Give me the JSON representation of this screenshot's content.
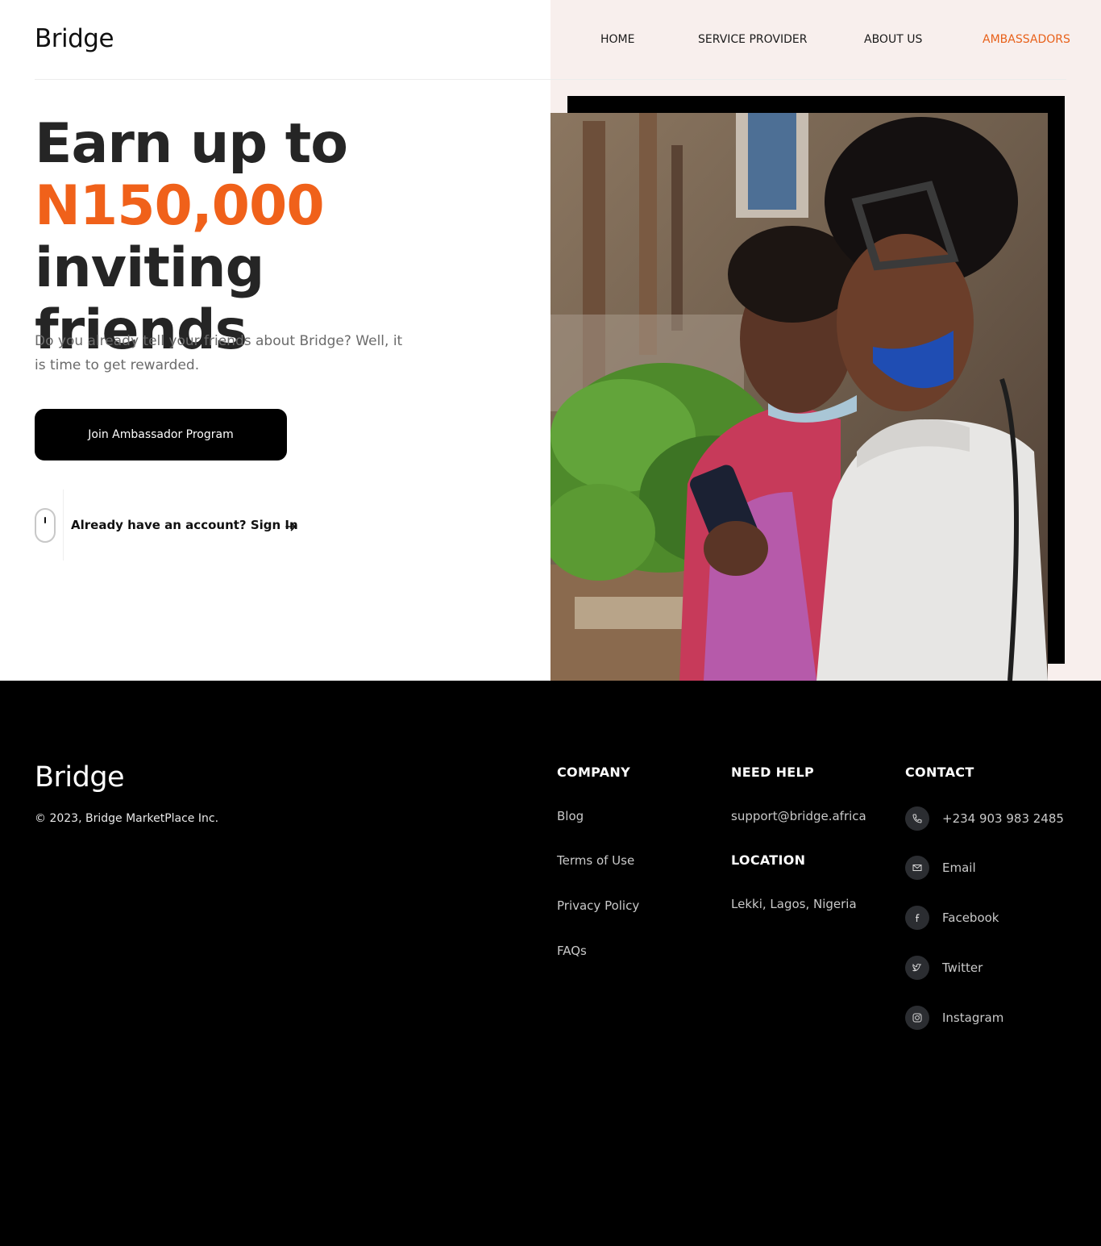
{
  "header": {
    "logo": "Bridge",
    "nav": [
      "HOME",
      "SERVICE PROVIDER",
      "ABOUT US",
      "AMBASSADORS"
    ],
    "active_nav": "AMBASSADORS"
  },
  "hero": {
    "headline_line1": "Earn up to",
    "headline_amount": "N150,000",
    "headline_line2_rest": " inviting",
    "headline_line3": "friends",
    "subtext": "Do you already tell your friends about Bridge? Well, it is time to get rewarded.",
    "cta_label": "Join Ambassador Program",
    "signin_text": "Already have an account? Sign In"
  },
  "colors": {
    "accent": "#f0611a",
    "right_panel_bg": "#f8efed",
    "footer_bg": "#000000"
  },
  "footer": {
    "logo": "Bridge",
    "copyright": "© 2023, Bridge MarketPlace Inc.",
    "company": {
      "heading": "COMPANY",
      "links": [
        "Blog",
        "Terms of Use",
        "Privacy Policy",
        "FAQs"
      ]
    },
    "help": {
      "heading": "NEED HELP",
      "email": "support@bridge.africa"
    },
    "location": {
      "heading": "LOCATION",
      "text": "Lekki, Lagos, Nigeria"
    },
    "contact": {
      "heading": "CONTACT",
      "items": [
        {
          "icon": "phone-icon",
          "label": "+234 903 983 2485"
        },
        {
          "icon": "mail-icon",
          "label": "Email"
        },
        {
          "icon": "facebook-icon",
          "label": "Facebook"
        },
        {
          "icon": "twitter-icon",
          "label": "Twitter"
        },
        {
          "icon": "instagram-icon",
          "label": "Instagram"
        }
      ]
    }
  }
}
